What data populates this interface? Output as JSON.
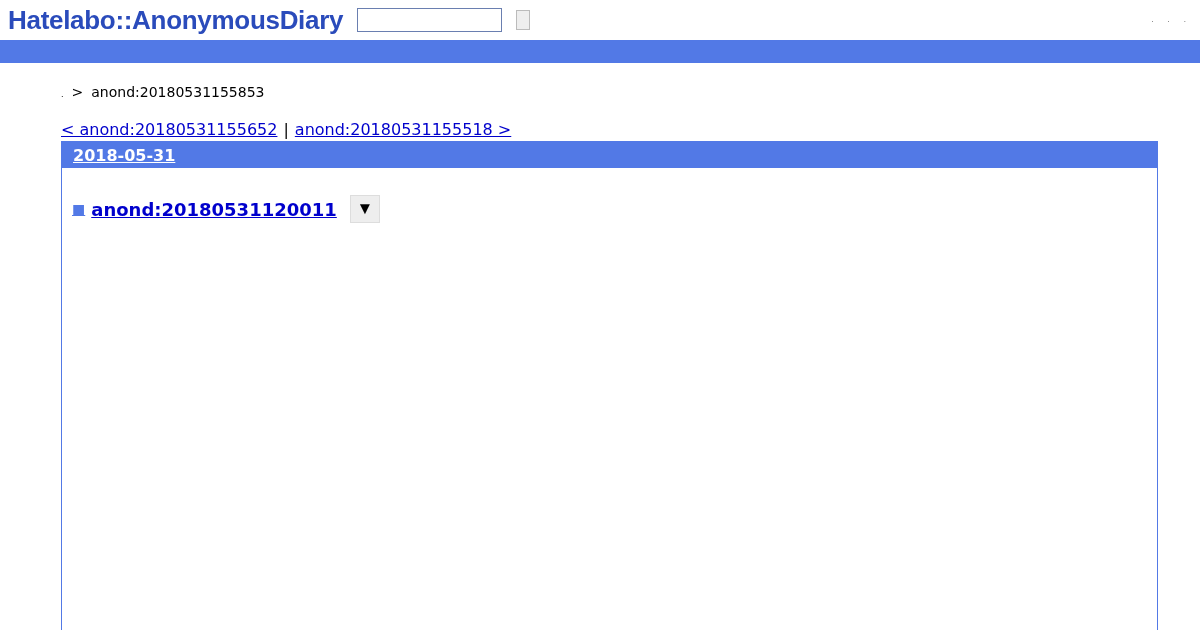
{
  "header": {
    "logo": "Hatelabo::AnonymousDiary",
    "links": [
      ".",
      ".",
      "."
    ]
  },
  "breadcrumb": {
    "home": ".",
    "separator": ">",
    "current": "anond:20180531155853"
  },
  "pager": {
    "prev": "< anond:20180531155652",
    "separator": "|",
    "next": "anond:20180531155518 >"
  },
  "day": {
    "date": "2018-05-31",
    "entries": [
      {
        "marker": "■",
        "title": "anond:20180531120011",
        "menu": "▼"
      }
    ]
  }
}
